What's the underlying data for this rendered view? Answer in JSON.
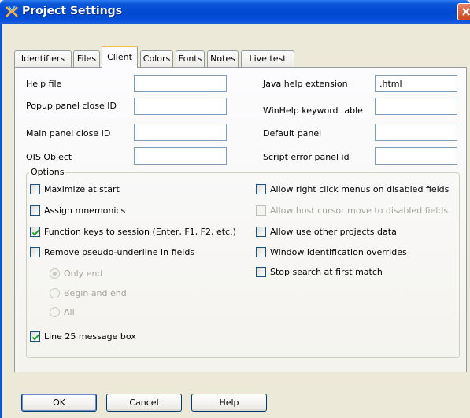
{
  "window": {
    "title": "Project Settings"
  },
  "tabs": [
    {
      "label": "Identifiers",
      "mnemonic": "I",
      "active": false
    },
    {
      "label": "Files",
      "mnemonic": "F",
      "active": false
    },
    {
      "label": "Client",
      "mnemonic": "C",
      "active": true
    },
    {
      "label": "Colors",
      "mnemonic": "C",
      "active": false
    },
    {
      "label": "Fonts",
      "mnemonic": "o",
      "active": false
    },
    {
      "label": "Notes",
      "mnemonic": "N",
      "active": false
    },
    {
      "label": "Live test",
      "mnemonic": "L",
      "active": false
    }
  ],
  "fields": {
    "help_file": {
      "label": "Help file",
      "value": ""
    },
    "popup_close": {
      "label": "Popup panel close ID",
      "value": ""
    },
    "main_close": {
      "label": "Main panel close ID",
      "value": ""
    },
    "ois_object": {
      "label": "OIS Object",
      "value": ""
    },
    "java_ext": {
      "label": "Java help extension",
      "value": ".html"
    },
    "winhelp_table": {
      "label": "WinHelp keyword table",
      "value": ""
    },
    "default_panel": {
      "label": "Default panel",
      "value": ""
    },
    "script_error": {
      "label": "Script error panel id",
      "value": ""
    }
  },
  "options": {
    "legend": "Options",
    "maximize": {
      "label": "Maximize at start",
      "checked": false
    },
    "mnemonics": {
      "label": "Assign mnemonics",
      "checked": false
    },
    "function_keys": {
      "label": "Function keys to session (Enter, F1, F2, etc.)",
      "checked": true
    },
    "remove_pseudo": {
      "label": "Remove pseudo-underline in fields",
      "checked": false
    },
    "radio_only_end": {
      "label": "Only end",
      "selected": true,
      "disabled": true
    },
    "radio_begin_end": {
      "label": "Begin and end",
      "selected": false,
      "disabled": true
    },
    "radio_all": {
      "label": "All",
      "selected": false,
      "disabled": true
    },
    "line25": {
      "label": "Line 25 message box",
      "checked": true
    },
    "right_click": {
      "label": "Allow right click menus on disabled fields",
      "checked": false
    },
    "host_cursor": {
      "label": "Allow host cursor move to disabled fields",
      "checked": false,
      "disabled": true
    },
    "other_projects": {
      "label": "Allow use other projects data",
      "checked": false
    },
    "window_id": {
      "label": "Window identification overrides",
      "checked": false
    },
    "stop_search": {
      "label": "Stop search at first match",
      "checked": false
    }
  },
  "buttons": {
    "ok": "OK",
    "cancel": "Cancel",
    "help": "Help"
  },
  "colors": {
    "titlebar": "#0048d0",
    "close": "#c9471f",
    "active_tab_accent": "#f7bd4a",
    "check": "#21a121"
  },
  "icons": {
    "title": "project-settings-icon",
    "close": "close-icon",
    "check": "checkmark-icon"
  }
}
